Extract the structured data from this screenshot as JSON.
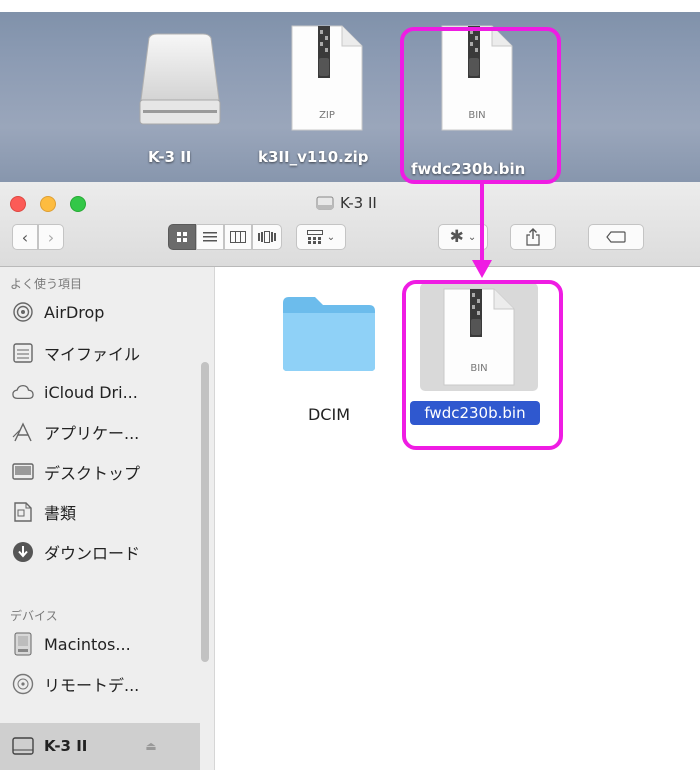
{
  "desktop": {
    "items": [
      {
        "label": "K-3 II",
        "icon": "drive-icon"
      },
      {
        "label": "k3II_v110.zip",
        "icon": "zip-file-icon",
        "badge": "ZIP"
      },
      {
        "label": "fwdc230b.bin",
        "icon": "bin-file-icon",
        "badge": "BIN"
      }
    ]
  },
  "window": {
    "title": "K-3 II",
    "toolbar": {
      "view_icons": [
        "icon-view",
        "list-view",
        "column-view",
        "coverflow-view"
      ]
    }
  },
  "sidebar": {
    "favorites_header": "よく使う項目",
    "favorites": [
      {
        "label": "AirDrop",
        "icon": "airdrop-icon"
      },
      {
        "label": "マイファイル",
        "icon": "all-files-icon"
      },
      {
        "label": "iCloud Dri...",
        "icon": "cloud-icon"
      },
      {
        "label": "アプリケー...",
        "icon": "applications-icon"
      },
      {
        "label": "デスクトップ",
        "icon": "desktop-icon"
      },
      {
        "label": "書類",
        "icon": "documents-icon"
      },
      {
        "label": "ダウンロード",
        "icon": "downloads-icon"
      }
    ],
    "devices_header": "デバイス",
    "devices": [
      {
        "label": "Macintos...",
        "icon": "hard-disk-icon"
      },
      {
        "label": "リモートデ...",
        "icon": "remote-disc-icon"
      },
      {
        "label": "K-3 II",
        "icon": "drive-icon",
        "selected": true
      }
    ]
  },
  "content": {
    "items": [
      {
        "label": "DCIM",
        "icon": "folder-icon"
      },
      {
        "label": "fwdc230b.bin",
        "icon": "bin-file-icon",
        "badge": "BIN",
        "selected": true
      }
    ]
  },
  "annotation": {
    "color": "#ef1ce3"
  }
}
